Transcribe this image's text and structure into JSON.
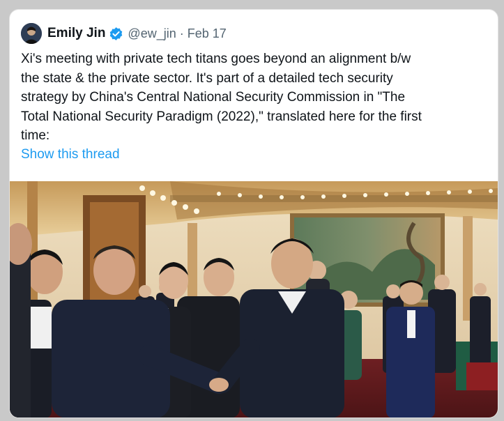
{
  "tweet": {
    "author": {
      "display_name": "Emily Jin",
      "handle": "@ew_jin",
      "verified": true,
      "verified_color": "#1d9bf0"
    },
    "separator": "·",
    "date": "Feb 17",
    "text_lines": [
      "Xi's meeting with private tech titans goes beyond an alignment b/w",
      "the state & the private sector. It's part of a detailed tech security",
      "strategy by China's Central National Security Commission in \"The",
      "Total National Security Paradigm (2022),\" translated here for the first",
      "time:"
    ],
    "show_thread_label": "Show this thread",
    "link_color": "#1d9bf0",
    "media": {
      "type": "photo",
      "alt_description": "Group of men in dark suits shaking hands in an ornate hall with a large landscape painting"
    }
  }
}
